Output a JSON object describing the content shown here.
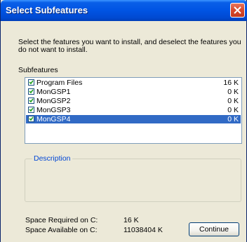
{
  "window": {
    "title": "Select Subfeatures"
  },
  "instructions": "Select the features you want to install, and deselect the features you do not want to install.",
  "subfeatures_label": "Subfeatures",
  "features": [
    {
      "label": "Program Files",
      "size": "16 K",
      "checked": true,
      "selected": false
    },
    {
      "label": "MonGSP1",
      "size": "0 K",
      "checked": true,
      "selected": false
    },
    {
      "label": "MonGSP2",
      "size": "0 K",
      "checked": true,
      "selected": false
    },
    {
      "label": "MonGSP3",
      "size": "0 K",
      "checked": true,
      "selected": false
    },
    {
      "label": "MonGSP4",
      "size": "0 K",
      "checked": true,
      "selected": true
    }
  ],
  "description": {
    "legend": "Description"
  },
  "space": {
    "required_label": "Space Required on C:",
    "required_value": "16 K",
    "available_label": "Space Available on C:",
    "available_value": "11038404 K"
  },
  "buttons": {
    "continue_label": "Continue"
  },
  "colors": {
    "titlebar": "#0054e3",
    "selection": "#316ac5",
    "close_button": "#d8492c",
    "description_legend": "#0046d5"
  }
}
